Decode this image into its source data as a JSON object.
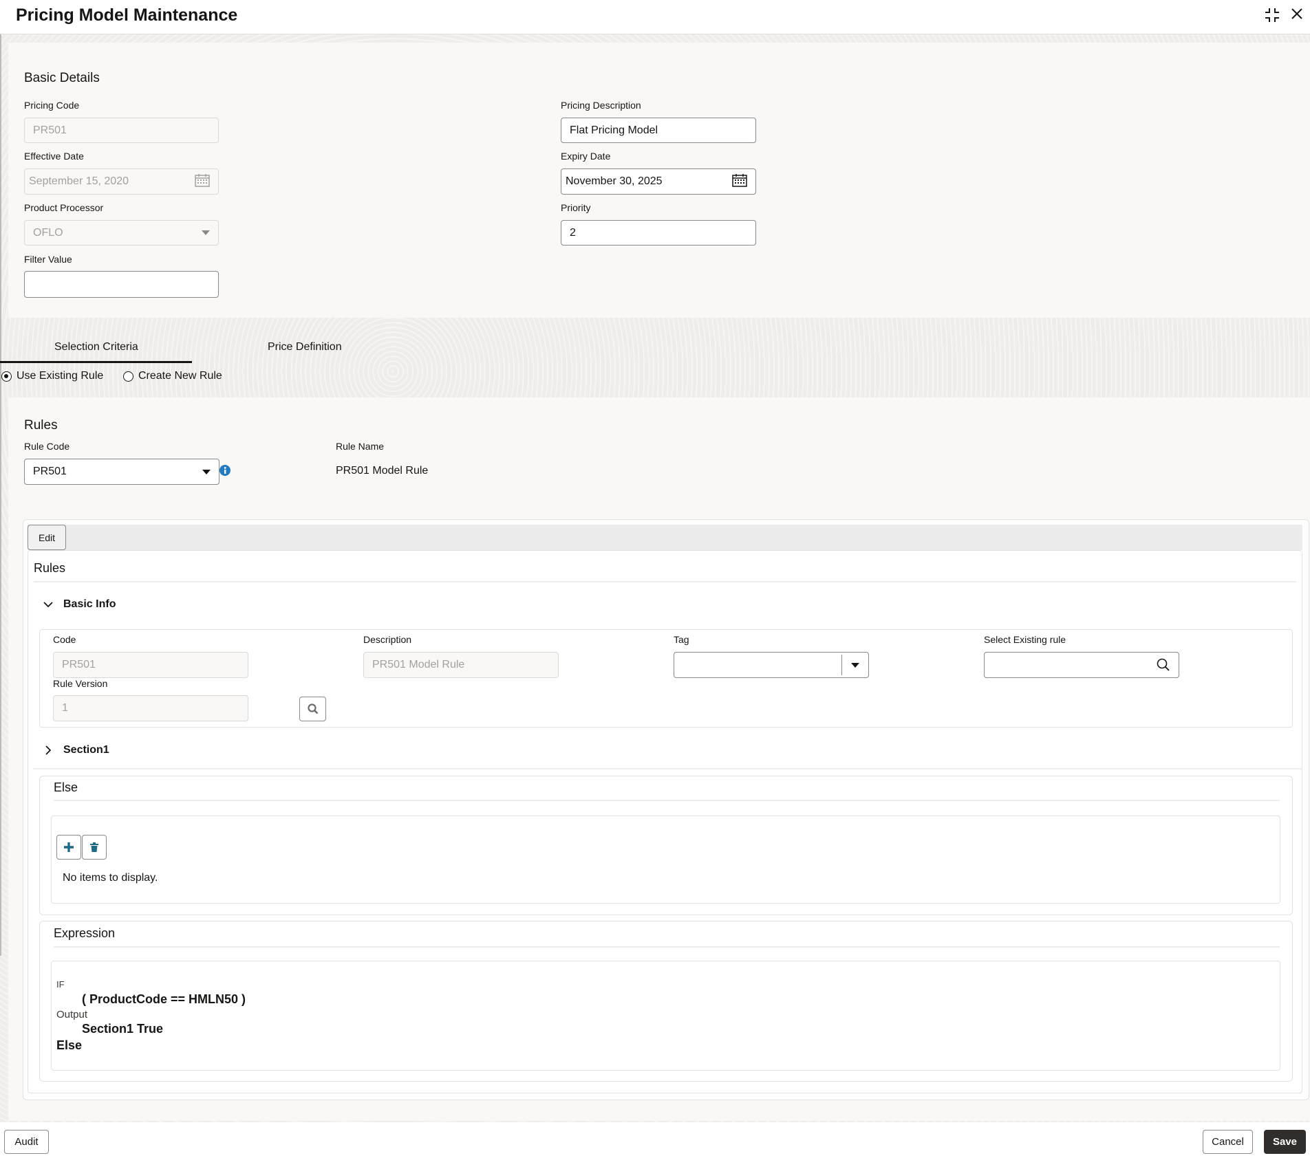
{
  "header": {
    "title": "Pricing Model Maintenance",
    "minimize_icon": "collapse-icon",
    "close_icon": "close-icon"
  },
  "basic_details": {
    "heading": "Basic Details",
    "pricing_code": {
      "label": "Pricing Code",
      "value": "PR501"
    },
    "effective_date": {
      "label": "Effective Date",
      "value": "September 15, 2020"
    },
    "product_processor": {
      "label": "Product Processor",
      "value": "OFLO"
    },
    "filter_value": {
      "label": "Filter Value",
      "value": ""
    },
    "pricing_description": {
      "label": "Pricing Description",
      "value": "Flat Pricing Model"
    },
    "expiry_date": {
      "label": "Expiry Date",
      "value": "November 30, 2025"
    },
    "priority": {
      "label": "Priority",
      "value": "2"
    }
  },
  "tabs": [
    {
      "label": "Selection Criteria",
      "active": true
    },
    {
      "label": "Price Definition",
      "active": false
    }
  ],
  "rule_mode": {
    "options": [
      {
        "label": "Use Existing Rule",
        "selected": true
      },
      {
        "label": "Create New Rule",
        "selected": false
      }
    ]
  },
  "rules": {
    "heading": "Rules",
    "rule_code": {
      "label": "Rule Code",
      "value": "PR501"
    },
    "rule_name": {
      "label": "Rule Name",
      "value": "PR501 Model Rule"
    },
    "info_icon": "info-icon"
  },
  "rule_editor": {
    "edit_label": "Edit",
    "title": "Rules",
    "basic_info": {
      "title": "Basic Info",
      "code": {
        "label": "Code",
        "value": "PR501"
      },
      "description": {
        "label": "Description",
        "value": "PR501 Model Rule"
      },
      "tag": {
        "label": "Tag",
        "value": ""
      },
      "select_existing": {
        "label": "Select Existing rule",
        "value": ""
      },
      "rule_version": {
        "label": "Rule Version",
        "value": "1"
      }
    },
    "section1": {
      "title": "Section1"
    },
    "else": {
      "title": "Else",
      "empty_text": "No items to display."
    },
    "expression": {
      "title": "Expression",
      "if_label": "IF",
      "condition": "( ProductCode == HMLN50 )",
      "output_label": "Output",
      "output_value": "Section1 True",
      "else_label": "Else"
    }
  },
  "footer": {
    "audit_label": "Audit",
    "cancel_label": "Cancel",
    "save_label": "Save"
  }
}
